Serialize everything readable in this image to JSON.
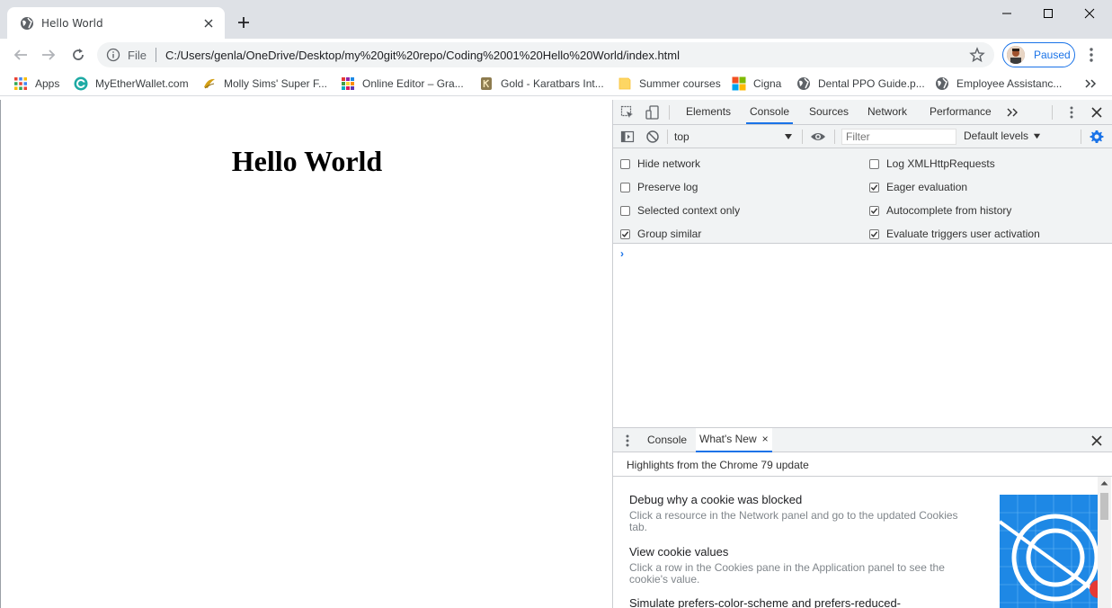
{
  "browser": {
    "tab_title": "Hello World",
    "address_scheme": "File",
    "address_url": "C:/Users/genla/OneDrive/Desktop/my%20git%20repo/Coding%2001%20Hello%20World/index.html",
    "profile_status": "Paused"
  },
  "bookmarks": [
    {
      "label": "Apps",
      "icon": "apps-grid-icon"
    },
    {
      "label": "MyEtherWallet.com",
      "icon": "myetherwallet-icon"
    },
    {
      "label": "Molly Sims' Super F...",
      "icon": "bookmark-site-icon"
    },
    {
      "label": "Online Editor – Gra...",
      "icon": "online-editor-icon"
    },
    {
      "label": "Gold - Karatbars Int...",
      "icon": "karatbars-icon"
    },
    {
      "label": "Summer courses",
      "icon": "folder-icon"
    },
    {
      "label": "Cigna",
      "icon": "microsoft-icon"
    },
    {
      "label": "Dental PPO Guide.p...",
      "icon": "globe-icon"
    },
    {
      "label": "Employee Assistanc...",
      "icon": "globe-icon"
    }
  ],
  "page": {
    "heading": "Hello World"
  },
  "devtools": {
    "tabs": [
      "Elements",
      "Console",
      "Sources",
      "Network",
      "Performance"
    ],
    "active_tab": "Console",
    "context": "top",
    "filter_placeholder": "Filter",
    "levels_label": "Default levels",
    "settings_left": [
      {
        "label": "Hide network",
        "checked": false
      },
      {
        "label": "Preserve log",
        "checked": false
      },
      {
        "label": "Selected context only",
        "checked": false
      },
      {
        "label": "Group similar",
        "checked": true
      }
    ],
    "settings_right": [
      {
        "label": "Log XMLHttpRequests",
        "checked": false
      },
      {
        "label": "Eager evaluation",
        "checked": true
      },
      {
        "label": "Autocomplete from history",
        "checked": true
      },
      {
        "label": "Evaluate triggers user activation",
        "checked": true
      }
    ],
    "prompt": "›",
    "drawer_tabs": [
      "Console",
      "What's New"
    ],
    "drawer_active": "What's New",
    "drawer_close": "×",
    "highlights": "Highlights from the Chrome 79 update",
    "whats_new": [
      {
        "title": "Debug why a cookie was blocked",
        "desc": "Click a resource in the Network panel and go to the updated Cookies tab."
      },
      {
        "title": "View cookie values",
        "desc": "Click a row in the Cookies pane in the Application panel to see the cookie's value."
      },
      {
        "title": "Simulate prefers-color-scheme and prefers-reduced-",
        "desc": ""
      }
    ]
  }
}
